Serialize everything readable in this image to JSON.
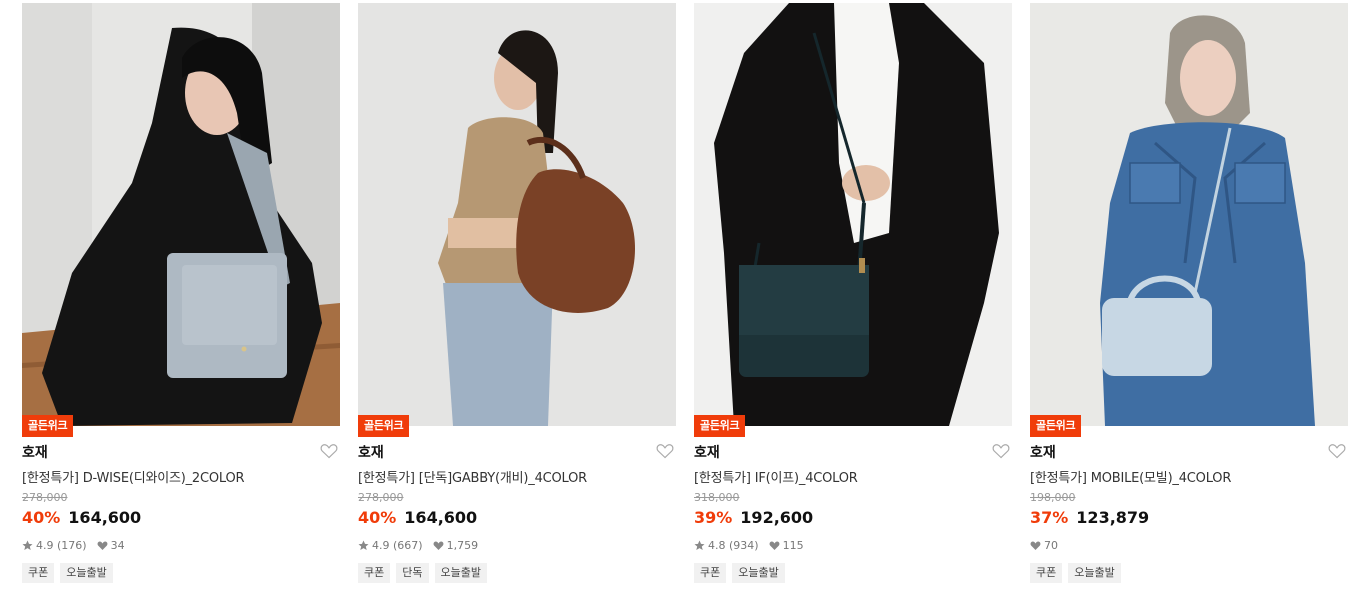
{
  "colors": {
    "accent": "#f03c0a",
    "badge_text": "#ffffff"
  },
  "products": [
    {
      "badge": "골든위크",
      "brand": "호재",
      "name": "[한정특가] D-WISE(디와이즈)_2COLOR",
      "original_price": "278,000",
      "discount": "40%",
      "price": "164,600",
      "rating": "4.9",
      "reviews": "(176)",
      "likes": "34",
      "tags": [
        "쿠폰",
        "오늘출발"
      ]
    },
    {
      "badge": "골든위크",
      "brand": "호재",
      "name": "[한정특가] [단독]GABBY(개비)_4COLOR",
      "original_price": "278,000",
      "discount": "40%",
      "price": "164,600",
      "rating": "4.9",
      "reviews": "(667)",
      "likes": "1,759",
      "tags": [
        "쿠폰",
        "단독",
        "오늘출발"
      ]
    },
    {
      "badge": "골든위크",
      "brand": "호재",
      "name": "[한정특가] IF(이프)_4COLOR",
      "original_price": "318,000",
      "discount": "39%",
      "price": "192,600",
      "rating": "4.8",
      "reviews": "(934)",
      "likes": "115",
      "tags": [
        "쿠폰",
        "오늘출발"
      ]
    },
    {
      "badge": "골든위크",
      "brand": "호재",
      "name": "[한정특가] MOBILE(모빌)_4COLOR",
      "original_price": "198,000",
      "discount": "37%",
      "price": "123,879",
      "rating": "",
      "reviews": "",
      "likes": "70",
      "tags": [
        "쿠폰",
        "오늘출발"
      ]
    }
  ]
}
